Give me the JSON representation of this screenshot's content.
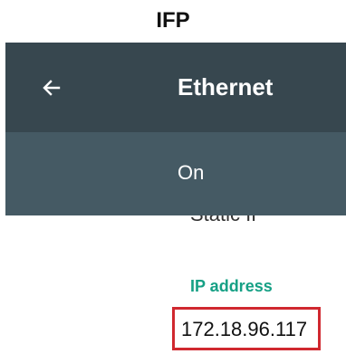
{
  "caption": "IFP",
  "appbar": {
    "back_icon": "arrow-left-icon",
    "title": "Ethernet"
  },
  "ethernet_switch": {
    "label": "On"
  },
  "partially_hidden": {
    "text": "Static IP"
  },
  "ip_address": {
    "label": "IP address",
    "value": "172.18.96.117"
  },
  "colors": {
    "appbar": "#37474f",
    "switchbar": "#455a64",
    "label_accent": "#16a085",
    "highlight_border": "#d0282f"
  }
}
